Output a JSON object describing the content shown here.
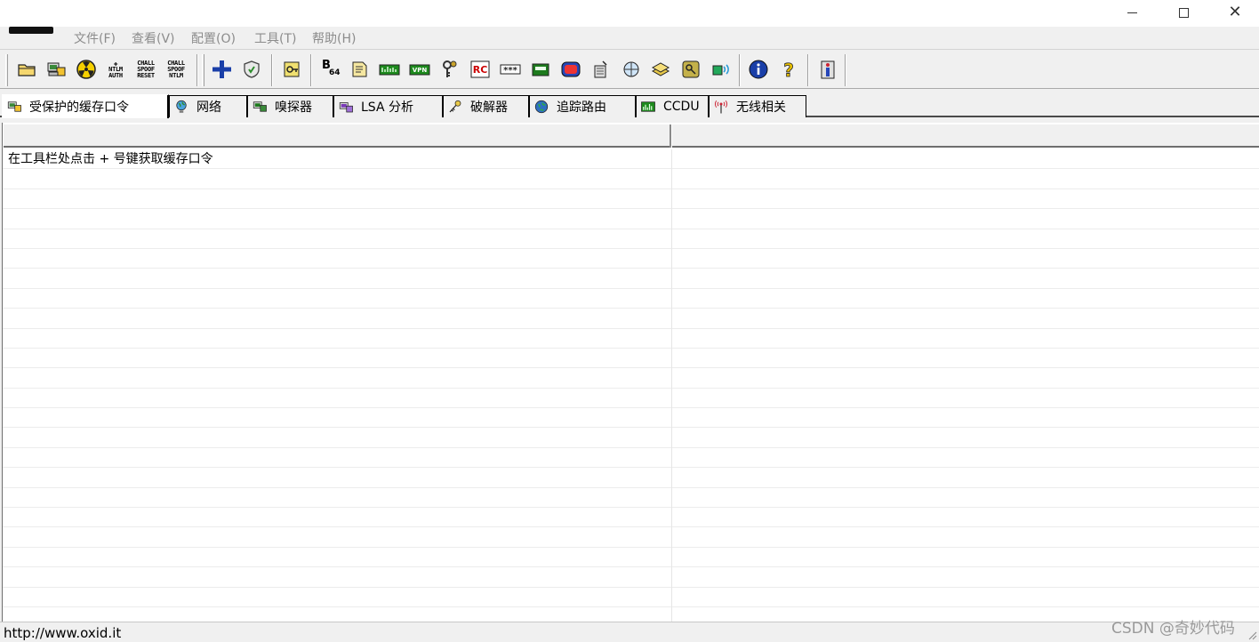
{
  "menu": {
    "items": [
      "文件(F)",
      "查看(V)",
      "配置(O)",
      "工具(T)",
      "帮助(H)"
    ]
  },
  "toolbar": {
    "ntlm_auth": [
      "NTLM",
      "AUTH"
    ],
    "chall_spoof_reset": [
      "CHALL",
      "SPOOF",
      "RESET"
    ],
    "chall_spoof_ntlm": [
      "CHALL",
      "SPOOF",
      "NTLM"
    ],
    "base64_b": "B",
    "base64_n": "64"
  },
  "tabs": [
    {
      "label": "受保护的缓存口令"
    },
    {
      "label": "网络"
    },
    {
      "label": "嗅探器"
    },
    {
      "label": "LSA 分析"
    },
    {
      "label": "破解器"
    },
    {
      "label": "追踪路由"
    },
    {
      "label": "CCDU"
    },
    {
      "label": "无线相关"
    }
  ],
  "list": {
    "first_row_text": "在工具栏处点击 + 号键获取缓存口令"
  },
  "status": {
    "url": "http://www.oxid.it"
  },
  "watermark": "CSDN @奇妙代码",
  "colors": {
    "menu_text": "#8c8c8c",
    "add_button": "#1a3fa8",
    "info_button": "#1a3fa8"
  }
}
